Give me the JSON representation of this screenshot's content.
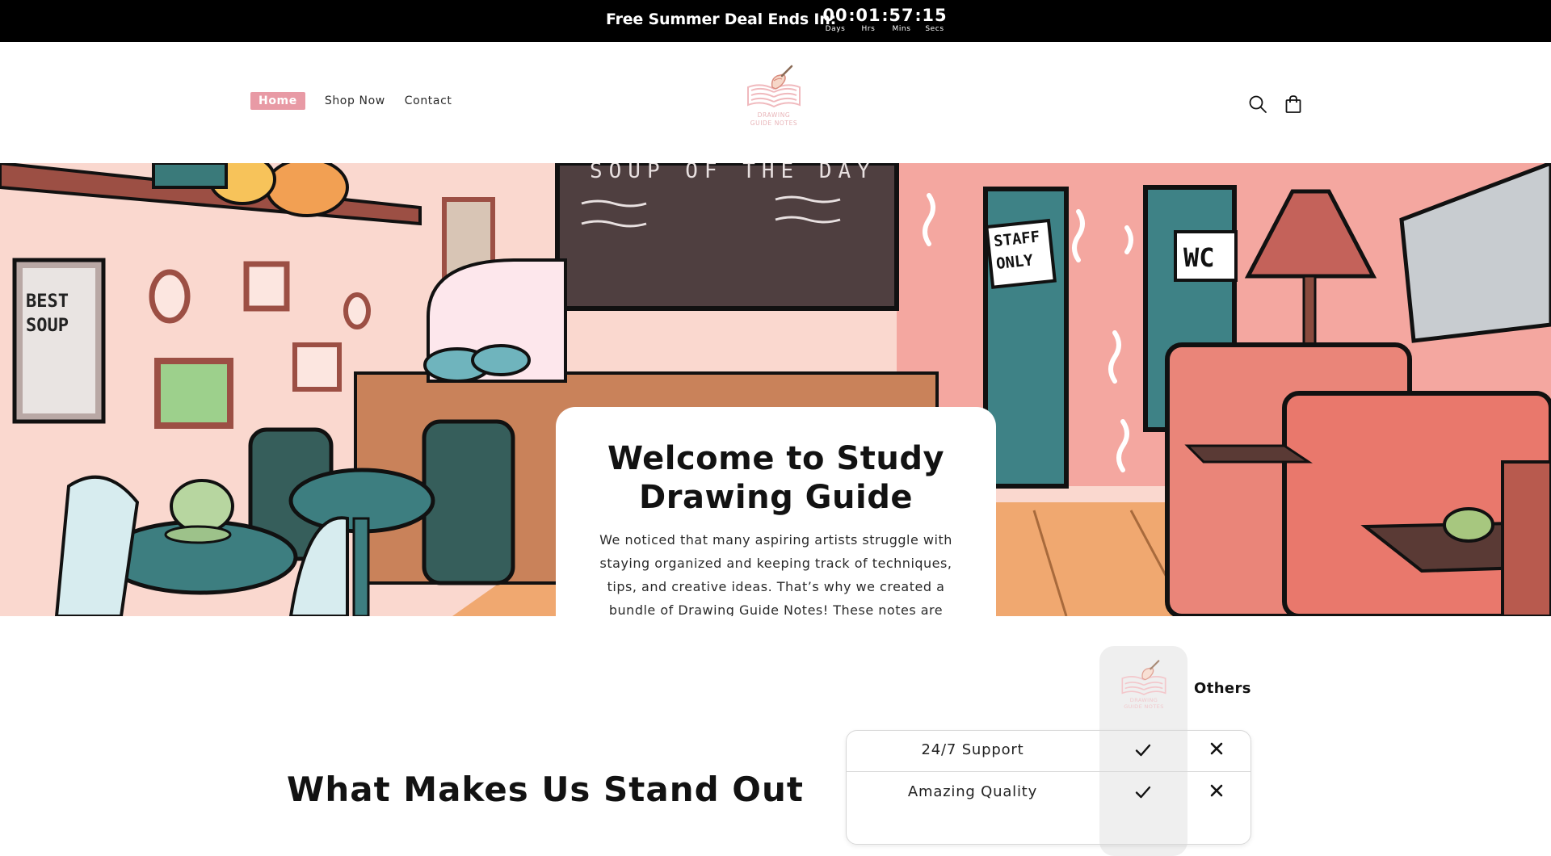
{
  "announcement": {
    "text": "Free Summer Deal Ends In:",
    "countdown": [
      {
        "value": "00",
        "label": "Days"
      },
      {
        "value": "01",
        "label": "Hrs"
      },
      {
        "value": "57",
        "label": "Mins"
      },
      {
        "value": "15",
        "label": "Secs"
      }
    ],
    "separator": ":"
  },
  "nav": {
    "items": [
      {
        "label": "Home",
        "active": true
      },
      {
        "label": "Shop Now",
        "active": false
      },
      {
        "label": "Contact",
        "active": false
      }
    ]
  },
  "logo": {
    "caption_line1": "DRAWING",
    "caption_line2": "GUIDE NOTES",
    "accent": "#e8a7ad"
  },
  "header_icons": {
    "search": "search-icon",
    "cart": "shopping-bag-icon"
  },
  "hero": {
    "title": "Welcome to Study Drawing Guide",
    "text": "We noticed that many aspiring artists struggle with staying organized and keeping track of techniques, tips, and creative ideas. That’s why we created a bundle of Drawing Guide Notes! These notes are designed to help you stay focused, build artistic confidence, and make mastering drawing skills more fun and approachable.",
    "illustration": {
      "chalkboard_text": "SOUP OF THE DAY",
      "sign_staff_line1": "STAFF",
      "sign_staff_line2": "ONLY",
      "sign_wc": "WC",
      "poster_line1": "BEST",
      "poster_line2": "SOUP"
    }
  },
  "comparison": {
    "section_title": "What Makes Us Stand Out",
    "others_label": "Others",
    "rows": [
      {
        "feature": "24/7 Support",
        "us": "check-icon",
        "others": "cross-icon"
      },
      {
        "feature": "Amazing Quality",
        "us": "check-icon",
        "others": "cross-icon"
      }
    ]
  },
  "colors": {
    "announcement_bg": "#000000",
    "nav_active_bg": "#e89aa5",
    "hero_wall_pink": "#fad8cf",
    "hero_floor": "#f0a870"
  }
}
